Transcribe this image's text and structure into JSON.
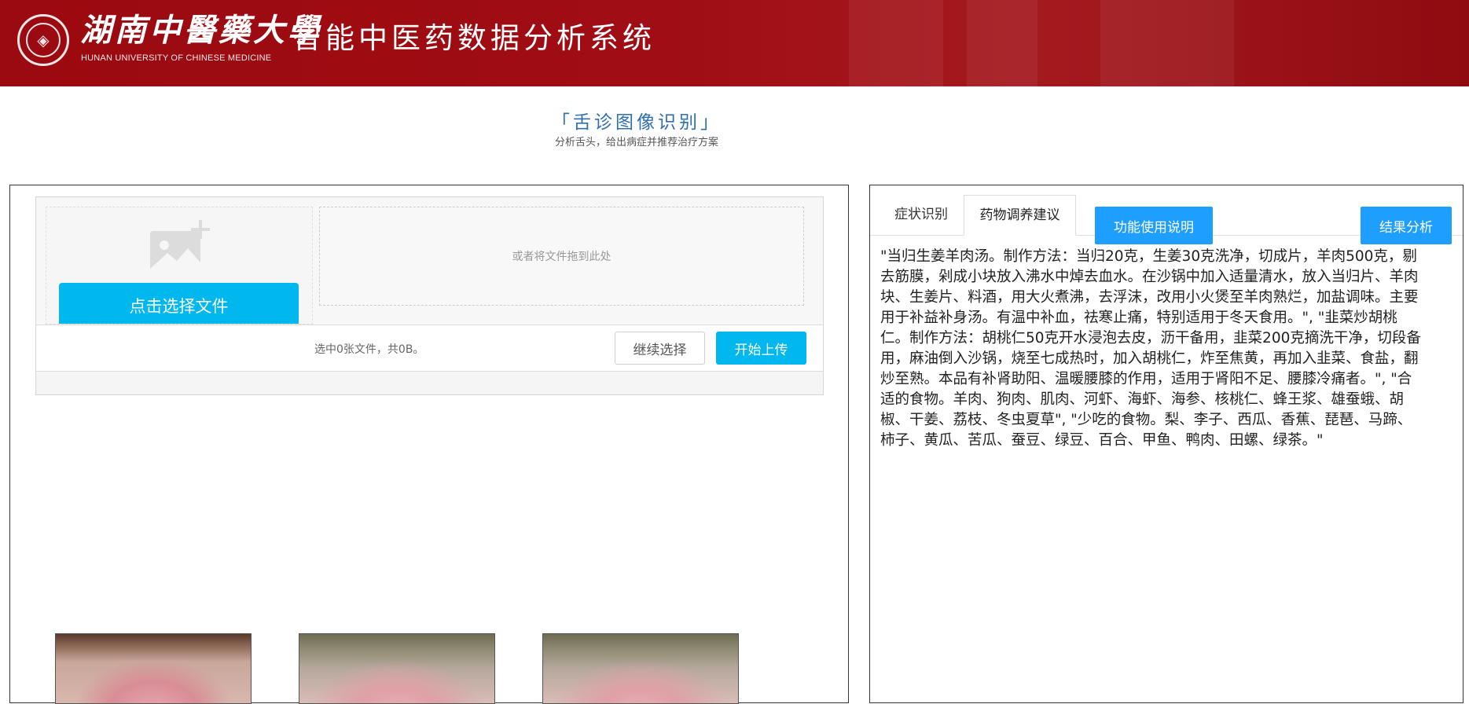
{
  "header": {
    "university_name_cn": "湖南中醫藥大學",
    "university_name_en": "HUNAN UNIVERSITY OF CHINESE MEDICINE",
    "system_title": "智能中医药数据分析系统",
    "colors": {
      "background": "#9b0a10",
      "text": "#ffffff"
    }
  },
  "page": {
    "title": "「舌诊图像识别」",
    "subtitle": "分析舌头，给出病症并推荐治疗方案"
  },
  "uploader": {
    "pick_button_label": "点击选择文件",
    "drop_hint": "或者将文件拖到此处",
    "status_text": "选中0张文件，共0B。",
    "continue_button_label": "继续选择",
    "upload_button_label": "开始上传",
    "icons": {
      "pick": "image-add-icon"
    },
    "accent_color": "#00b7ee"
  },
  "thumbnails": [
    {
      "name": "tongue-image-1"
    },
    {
      "name": "tongue-image-2"
    },
    {
      "name": "tongue-image-3"
    }
  ],
  "result_panel": {
    "tabs": [
      {
        "label": "症状识别",
        "active": false
      },
      {
        "label": "药物调养建议",
        "active": true
      }
    ],
    "help_button_label": "功能使用说明",
    "result_button_label": "结果分析",
    "button_color": "#1e9fff",
    "content": "\"当归生姜羊肉汤。制作方法：当归20克，生姜30克洗净，切成片，羊肉500克，剔去筋膜，剁成小块放入沸水中焯去血水。在沙锅中加入适量清水，放入当归片、羊肉块、生姜片、料酒，用大火煮沸，去浮沫，改用小火煲至羊肉熟烂，加盐调味。主要用于补益补身汤。有温中补血，祛寒止痛，特别适用于冬天食用。\", \"韭菜炒胡桃仁。制作方法：胡桃仁50克开水浸泡去皮，沥干备用，韭菜200克摘洗干净，切段备用，麻油倒入沙锅，烧至七成热时，加入胡桃仁，炸至焦黄，再加入韭菜、食盐，翻炒至熟。本品有补肾助阳、温暖腰膝的作用，适用于肾阳不足、腰膝冷痛者。\", \"合适的食物。羊肉、狗肉、肌肉、河虾、海虾、海参、核桃仁、蜂王浆、雄蚕蛾、胡椒、干姜、荔枝、冬虫夏草\", \"少吃的食物。梨、李子、西瓜、香蕉、琵琶、马蹄、柿子、黄瓜、苦瓜、蚕豆、绿豆、百合、甲鱼、鸭肉、田螺、绿茶。\""
  }
}
